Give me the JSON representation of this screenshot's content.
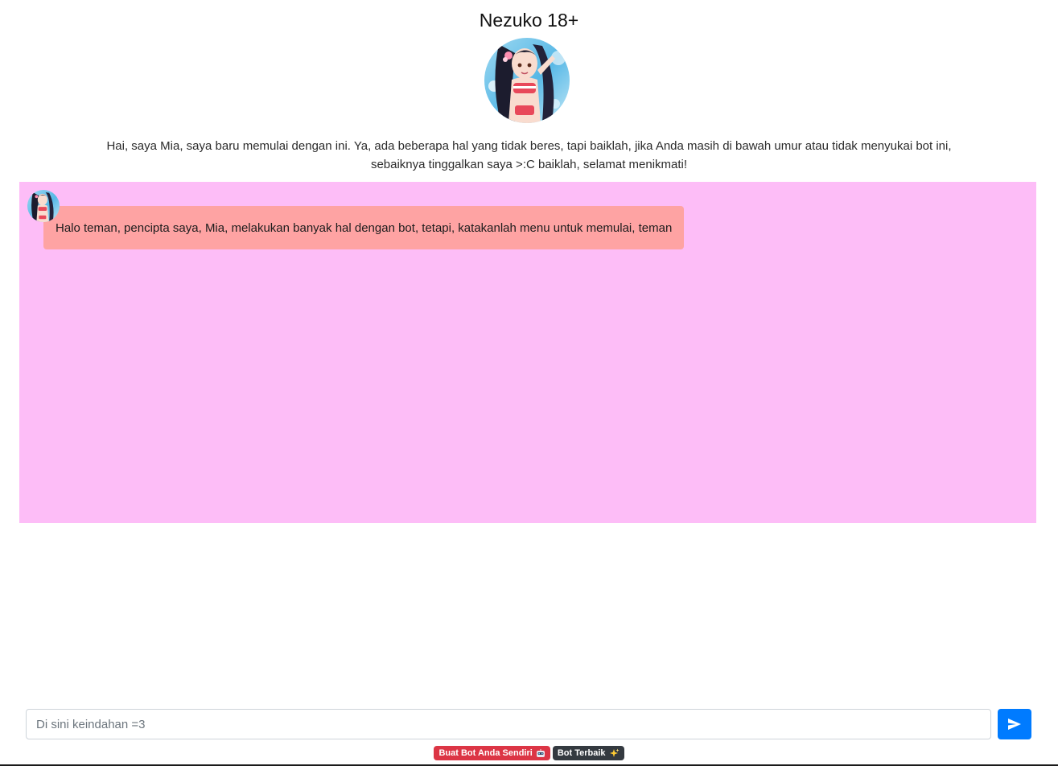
{
  "header": {
    "title": "Nezuko 18+",
    "description": "Hai, saya Mia, saya baru memulai dengan ini. Ya, ada beberapa hal yang tidak beres, tapi baiklah, jika Anda masih di bawah umur atau tidak menyukai bot ini, sebaiknya tinggalkan saya >:C baiklah, selamat menikmati!"
  },
  "chat": {
    "background": "#fdbdf7",
    "messages": [
      {
        "sender": "bot",
        "text": "Halo teman, pencipta saya, Mia, melakukan banyak hal dengan bot, tetapi, katakanlah menu untuk memulai, teman",
        "bubble_color": "#fea3a3"
      }
    ]
  },
  "composer": {
    "placeholder": "Di sini keindahan =3",
    "value": "",
    "send_icon": "send-icon"
  },
  "footer": {
    "create_bot_label": "Buat Bot Anda Sendiri",
    "create_bot_icon": "robot-icon",
    "best_bot_label": "Bot Terbaik",
    "best_bot_icon": "sparkles-icon"
  },
  "colors": {
    "accent": "#007bff",
    "danger": "#dc3545",
    "dark": "#343a40"
  }
}
